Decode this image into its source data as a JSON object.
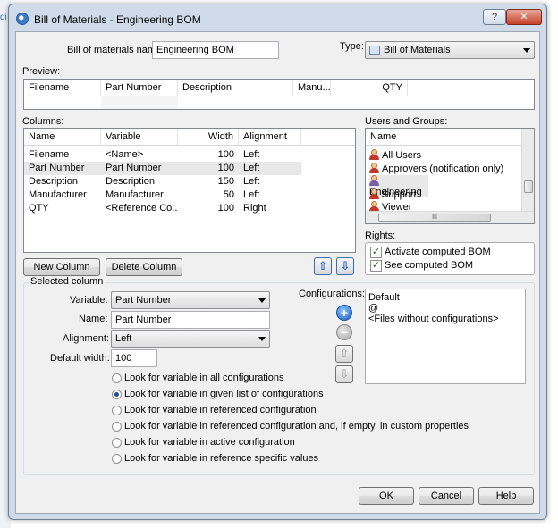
{
  "window": {
    "title": "Bill of Materials - Engineering BOM",
    "help_label": "?",
    "close_label": "✕"
  },
  "bom_name": {
    "label": "Bill of materials name:",
    "value": "Engineering BOM"
  },
  "type": {
    "label": "Type:",
    "value": "Bill of Materials"
  },
  "preview": {
    "label": "Preview:",
    "headers": [
      "Filename",
      "Part Number",
      "Description",
      "Manu...",
      "QTY"
    ]
  },
  "columns": {
    "label": "Columns:",
    "headers": [
      "Name",
      "Variable",
      "Width",
      "Alignment"
    ],
    "rows": [
      {
        "name": "Filename",
        "variable": "<Name>",
        "width": "100",
        "alignment": "Left"
      },
      {
        "name": "Part Number",
        "variable": "Part Number",
        "width": "100",
        "alignment": "Left"
      },
      {
        "name": "Description",
        "variable": "Description",
        "width": "150",
        "alignment": "Left"
      },
      {
        "name": "Manufacturer",
        "variable": "Manufacturer",
        "width": "50",
        "alignment": "Left"
      },
      {
        "name": "QTY",
        "variable": "<Reference Co...",
        "width": "100",
        "alignment": "Right"
      }
    ],
    "new_button": "New Column",
    "delete_button": "Delete Column"
  },
  "users_groups": {
    "label": "Users and Groups:",
    "header": "Name",
    "items": [
      "All Users",
      "Approvers (notification only)",
      "Engineering",
      "Support",
      "Viewer"
    ],
    "scroll_mark": "III"
  },
  "rights": {
    "label": "Rights:",
    "items": [
      {
        "label": "Activate computed BOM",
        "checked": true
      },
      {
        "label": "See computed BOM",
        "checked": true
      }
    ]
  },
  "selected_column": {
    "label": "Selected column",
    "variable_label": "Variable:",
    "variable_value": "Part Number",
    "name_label": "Name:",
    "name_value": "Part Number",
    "alignment_label": "Alignment:",
    "alignment_value": "Left",
    "width_label": "Default width:",
    "width_value": "100"
  },
  "lookup_options": [
    {
      "label": "Look for variable in all configurations",
      "selected": false
    },
    {
      "label": "Look for variable in given list of configurations",
      "selected": true
    },
    {
      "label": "Look for variable in referenced configuration",
      "selected": false
    },
    {
      "label": "Look for variable in referenced configuration and, if empty, in custom properties",
      "selected": false
    },
    {
      "label": "Look for variable in active configuration",
      "selected": false
    },
    {
      "label": "Look for variable in reference specific values",
      "selected": false
    }
  ],
  "configurations": {
    "label": "Configurations:",
    "items": [
      "Default",
      "@",
      "<Files without configurations>"
    ]
  },
  "footer": {
    "ok": "OK",
    "cancel": "Cancel",
    "help": "Help"
  },
  "colors": {
    "accent": "#1c5fc4",
    "window_frame": "#cfdbe9",
    "dialog_bg": "#f0f0f0"
  },
  "icons": {
    "up_arrow": "⇧",
    "down_arrow": "⇩",
    "add": "+",
    "remove": "−"
  }
}
